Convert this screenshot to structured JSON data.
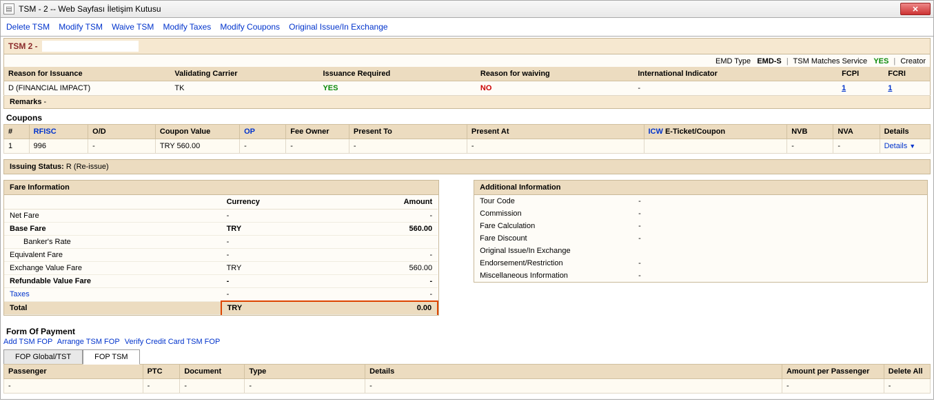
{
  "window": {
    "title": "TSM - 2 -- Web Sayfası İletişim Kutusu",
    "close": "✕"
  },
  "toolbar": {
    "delete": "Delete TSM",
    "modify": "Modify TSM",
    "waive": "Waive TSM",
    "taxes": "Modify Taxes",
    "coupons": "Modify Coupons",
    "original": "Original Issue/In Exchange"
  },
  "tsm": {
    "label": "TSM 2 -"
  },
  "meta": {
    "emd_type_label": "EMD Type",
    "emd_type": "EMD-S",
    "matches_label": "TSM Matches Service",
    "matches": "YES",
    "creator_label": "Creator"
  },
  "info_headers": {
    "reason": "Reason for Issuance",
    "carrier": "Validating Carrier",
    "issuance": "Issuance Required",
    "waiving": "Reason for waiving",
    "intl": "International Indicator",
    "fcpi": "FCPI",
    "fcri": "FCRI"
  },
  "info_row": {
    "reason": "D (FINANCIAL IMPACT)",
    "carrier": "TK",
    "issuance": "YES",
    "waiving": "NO",
    "intl": "-",
    "fcpi": "1",
    "fcri": "1"
  },
  "remarks_label": "Remarks",
  "remarks_value": "-",
  "coupons_title": "Coupons",
  "coupon_headers": {
    "n": "#",
    "rfisc": "RFISC",
    "od": "O/D",
    "value": "Coupon Value",
    "op": "OP",
    "owner": "Fee Owner",
    "present_to": "Present To",
    "present_at": "Present At",
    "icw": "ICW",
    "eticket": " E-Ticket/Coupon",
    "nvb": "NVB",
    "nva": "NVA",
    "details": "Details"
  },
  "coupon_row": {
    "n": "1",
    "rfisc": "996",
    "od": "-",
    "value": "TRY 560.00",
    "op": "-",
    "owner": "-",
    "present_to": "-",
    "present_at": "-",
    "eticket": "",
    "nvb": "-",
    "nva": "-",
    "details": "Details"
  },
  "issuing": {
    "label": "Issuing Status:",
    "value": "R (Re-issue)"
  },
  "fare_title": "Fare Information",
  "fare_headers": {
    "currency": "Currency",
    "amount": "Amount"
  },
  "fare_rows": {
    "net": {
      "label": "Net Fare",
      "cur": "-",
      "amt": "-"
    },
    "base": {
      "label": "Base Fare",
      "cur": "TRY",
      "amt": "560.00"
    },
    "bankers": {
      "label": "Banker's Rate",
      "cur": "-",
      "amt": ""
    },
    "equiv": {
      "label": "Equivalent Fare",
      "cur": "-",
      "amt": "-"
    },
    "exchange": {
      "label": "Exchange Value Fare",
      "cur": "TRY",
      "amt": "560.00"
    },
    "refund": {
      "label": "Refundable Value Fare",
      "cur": "-",
      "amt": "-"
    },
    "taxes": {
      "label": "Taxes",
      "cur": "-",
      "amt": "-"
    },
    "total": {
      "label": "Total",
      "cur": "TRY",
      "amt": "0.00"
    }
  },
  "addl_title": "Additional Information",
  "addl": {
    "tour": {
      "label": "Tour Code",
      "val": "-"
    },
    "commission": {
      "label": "Commission",
      "val": "-"
    },
    "fare_calc": {
      "label": "Fare Calculation",
      "val": "-"
    },
    "fare_disc": {
      "label": "Fare Discount",
      "val": "-"
    },
    "original": {
      "label": "Original Issue/In Exchange",
      "val": ""
    },
    "endorse": {
      "label": "Endorsement/Restriction",
      "val": "-"
    },
    "misc": {
      "label": "Miscellaneous Information",
      "val": "-"
    }
  },
  "fop_title": "Form Of Payment",
  "fop_links": {
    "add": "Add TSM FOP",
    "arrange": "Arrange TSM FOP",
    "verify": "Verify Credit Card TSM FOP"
  },
  "fop_tabs": {
    "global": "FOP Global/TST",
    "tsm": "FOP TSM"
  },
  "fop_headers": {
    "passenger": "Passenger",
    "ptc": "PTC",
    "document": "Document",
    "type": "Type",
    "details": "Details",
    "amount": "Amount per Passenger",
    "delete": "Delete All"
  },
  "fop_row": {
    "passenger": "-",
    "ptc": "-",
    "document": "-",
    "type": "-",
    "details": "-",
    "amount": "-",
    "delete": "-"
  }
}
